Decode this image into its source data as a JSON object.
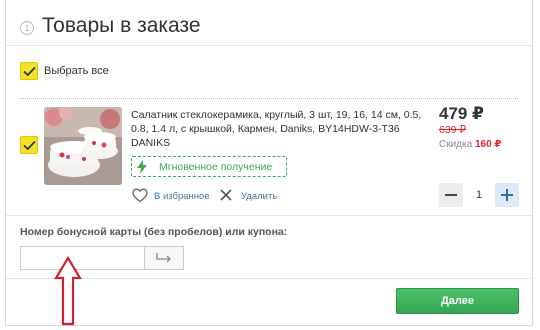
{
  "header": {
    "step_number": "1",
    "title": "Товары в заказе"
  },
  "select_all": {
    "label": "Выбрать все",
    "checked": true
  },
  "item": {
    "checked": true,
    "name": "Салатник стеклокерамика, круглый, 3 шт, 19, 16, 14 см, 0.5, 0.8, 1.4 л, с крышкой, Кармен, Daniks, BY14HDW-3-T36 DANIKS",
    "badge": "Мгновенное получение",
    "favorite_label": "В избранное",
    "delete_label": "Удалить",
    "price": "479 ₽",
    "price_old": "639 ₽",
    "discount_label": "Скидка",
    "discount_value": "160 ₽",
    "quantity": "1"
  },
  "coupon": {
    "label": "Номер бонусной карты (без пробелов) или купона:",
    "value": "",
    "placeholder": ""
  },
  "next_button": {
    "label": "Далее"
  },
  "colors": {
    "checkbox": "#f5e02a",
    "accent_green": "#3aaa55",
    "link_blue": "#4a6fa5",
    "price_red": "#e2242f",
    "annotation_arrow": "#d0242c"
  },
  "icons": {
    "checkmark": "check-icon",
    "instant": "lightning-icon",
    "favorite": "heart-icon",
    "delete": "close-icon",
    "apply": "arrow-return-icon"
  }
}
